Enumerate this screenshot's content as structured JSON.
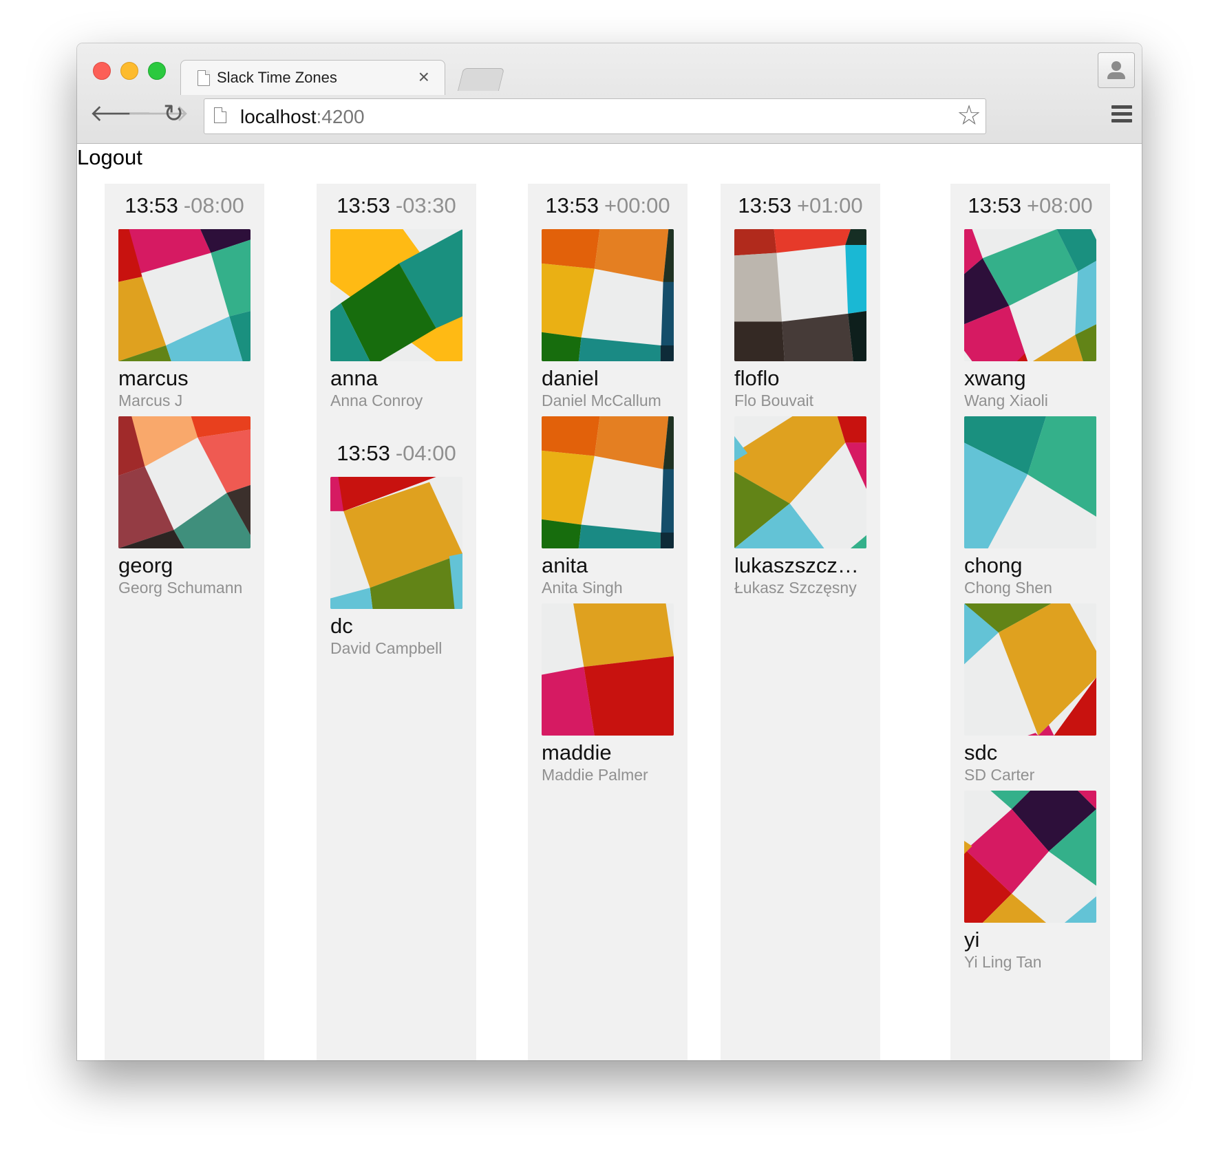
{
  "browser": {
    "tab_title": "Slack Time Zones",
    "tab_close": "×",
    "url_host": "localhost",
    "url_port": ":4200"
  },
  "page": {
    "logout_label": "Logout"
  },
  "timezones": [
    {
      "groups": [
        {
          "time": "13:53",
          "offset": "-08:00",
          "members": [
            {
              "username": "marcus",
              "name": "Marcus J"
            },
            {
              "username": "georg",
              "name": "Georg Schumann"
            }
          ]
        }
      ]
    },
    {
      "groups": [
        {
          "time": "13:53",
          "offset": "-03:30",
          "members": [
            {
              "username": "anna",
              "name": "Anna Conroy"
            }
          ]
        },
        {
          "time": "13:53",
          "offset": "-04:00",
          "members": [
            {
              "username": "dc",
              "name": "David Campbell"
            }
          ]
        }
      ]
    },
    {
      "groups": [
        {
          "time": "13:53",
          "offset": "+00:00",
          "members": [
            {
              "username": "daniel",
              "name": "Daniel McCallum"
            },
            {
              "username": "anita",
              "name": "Anita Singh"
            },
            {
              "username": "maddie",
              "name": "Maddie Palmer"
            }
          ]
        }
      ]
    },
    {
      "groups": [
        {
          "time": "13:53",
          "offset": "+01:00",
          "members": [
            {
              "username": "floflo",
              "name": "Flo Bouvait"
            },
            {
              "username": "lukaszszcz…",
              "name": "Łukasz Szczęsny"
            }
          ]
        }
      ]
    },
    {
      "groups": [
        {
          "time": "13:53",
          "offset": "+08:00",
          "members": [
            {
              "username": "xwang",
              "name": "Wang Xiaoli"
            },
            {
              "username": "chong",
              "name": "Chong Shen"
            },
            {
              "username": "sdc",
              "name": "SD Carter"
            },
            {
              "username": "yi",
              "name": "Yi Ling Tan"
            }
          ]
        }
      ]
    }
  ],
  "colors": {
    "red": "#c8120f",
    "pink": "#d61a62",
    "purple": "#2d0f3a",
    "teal": "#1a907f",
    "green": "#34b08a",
    "lightblue": "#63c3d6",
    "yellow": "#dfa11f",
    "olive": "#628417",
    "orange": "#e2610a",
    "darkteal": "#154e6a",
    "gray": "#bcb6ae",
    "darkbrown": "#3b302c",
    "cyan": "#1ab8d4",
    "paper": "#eceded"
  }
}
